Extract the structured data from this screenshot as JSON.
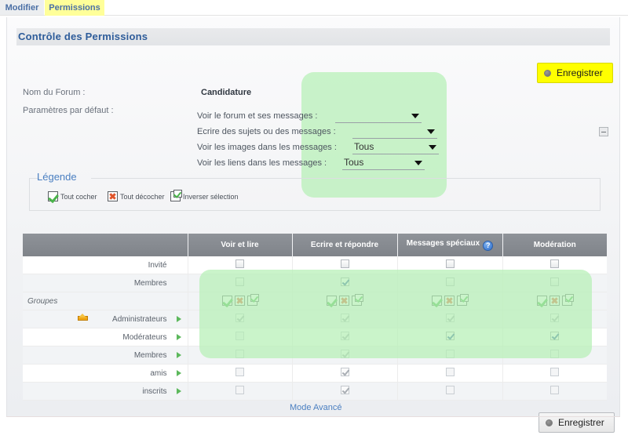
{
  "tabs": [
    {
      "label": "Modifier",
      "active": false
    },
    {
      "label": "Permissions",
      "active": true
    }
  ],
  "header": {
    "title": "Contrôle des Permissions",
    "save_label": "Enregistrer",
    "collapse_icon": "collapse-minus-icon"
  },
  "form": {
    "forum_name_label": "Nom du Forum :",
    "defaults_label": "Paramètres par défaut :",
    "forum_name_value": "Candidature",
    "rows": [
      {
        "label": "Voir le forum et ses messages :",
        "value": ""
      },
      {
        "label": "Ecrire des sujets ou des messages :",
        "value": ""
      },
      {
        "label": "Voir les images dans les messages :",
        "value": "Tous"
      },
      {
        "label": "Voir les liens dans les messages :",
        "value": "Tous"
      }
    ]
  },
  "legend": {
    "title": "Légende",
    "items": [
      {
        "label": "Tout cocher",
        "icon": "check-all-icon"
      },
      {
        "label": "Tout décocher",
        "icon": "uncheck-all-icon"
      },
      {
        "label": "Inverser sélection",
        "icon": "invert-selection-icon"
      }
    ]
  },
  "table": {
    "columns": [
      {
        "label": ""
      },
      {
        "label": "Voir et lire"
      },
      {
        "label": "Ecrire et répondre"
      },
      {
        "label": "Messages spéciaux",
        "help_icon": "?"
      },
      {
        "label": "Modération"
      }
    ],
    "rows": [
      {
        "name": "Invité",
        "kind": "entry",
        "crown": false,
        "arrow": false,
        "cells": [
          "off",
          "off",
          "off",
          "off"
        ]
      },
      {
        "name": "Membres",
        "kind": "entry",
        "crown": false,
        "arrow": false,
        "cells": [
          "off",
          "on",
          "off",
          "off"
        ]
      },
      {
        "name": "Groupes",
        "kind": "group-header",
        "crown": false,
        "arrow": false,
        "cells": [
          "trio",
          "trio",
          "trio",
          "trio"
        ]
      },
      {
        "name": "Administrateurs",
        "kind": "entry",
        "crown": true,
        "arrow": true,
        "cells": [
          "ondis",
          "ondis",
          "ondis",
          "ondis"
        ]
      },
      {
        "name": "Modérateurs",
        "kind": "entry",
        "crown": false,
        "arrow": true,
        "cells": [
          "dis",
          "ondis",
          "on",
          "on"
        ]
      },
      {
        "name": "Membres",
        "kind": "entry",
        "crown": false,
        "arrow": true,
        "cells": [
          "dis",
          "ondis",
          "dis",
          "dis"
        ]
      },
      {
        "name": "amis",
        "kind": "entry",
        "crown": false,
        "arrow": true,
        "cells": [
          "dis",
          "ondis",
          "dis",
          "dis"
        ]
      },
      {
        "name": "inscrits",
        "kind": "entry",
        "crown": false,
        "arrow": true,
        "cells": [
          "dis",
          "ondis",
          "dis",
          "dis"
        ]
      }
    ]
  },
  "footer": {
    "advanced_link": "Mode Avancé",
    "save_label": "Enregistrer"
  },
  "colors": {
    "tab_active": "#ffff00",
    "highlight_green": "#b6f0b6",
    "title_blue": "#2e5c9a",
    "link_blue": "#4a7fc1",
    "header_gray": "#8f9399"
  }
}
